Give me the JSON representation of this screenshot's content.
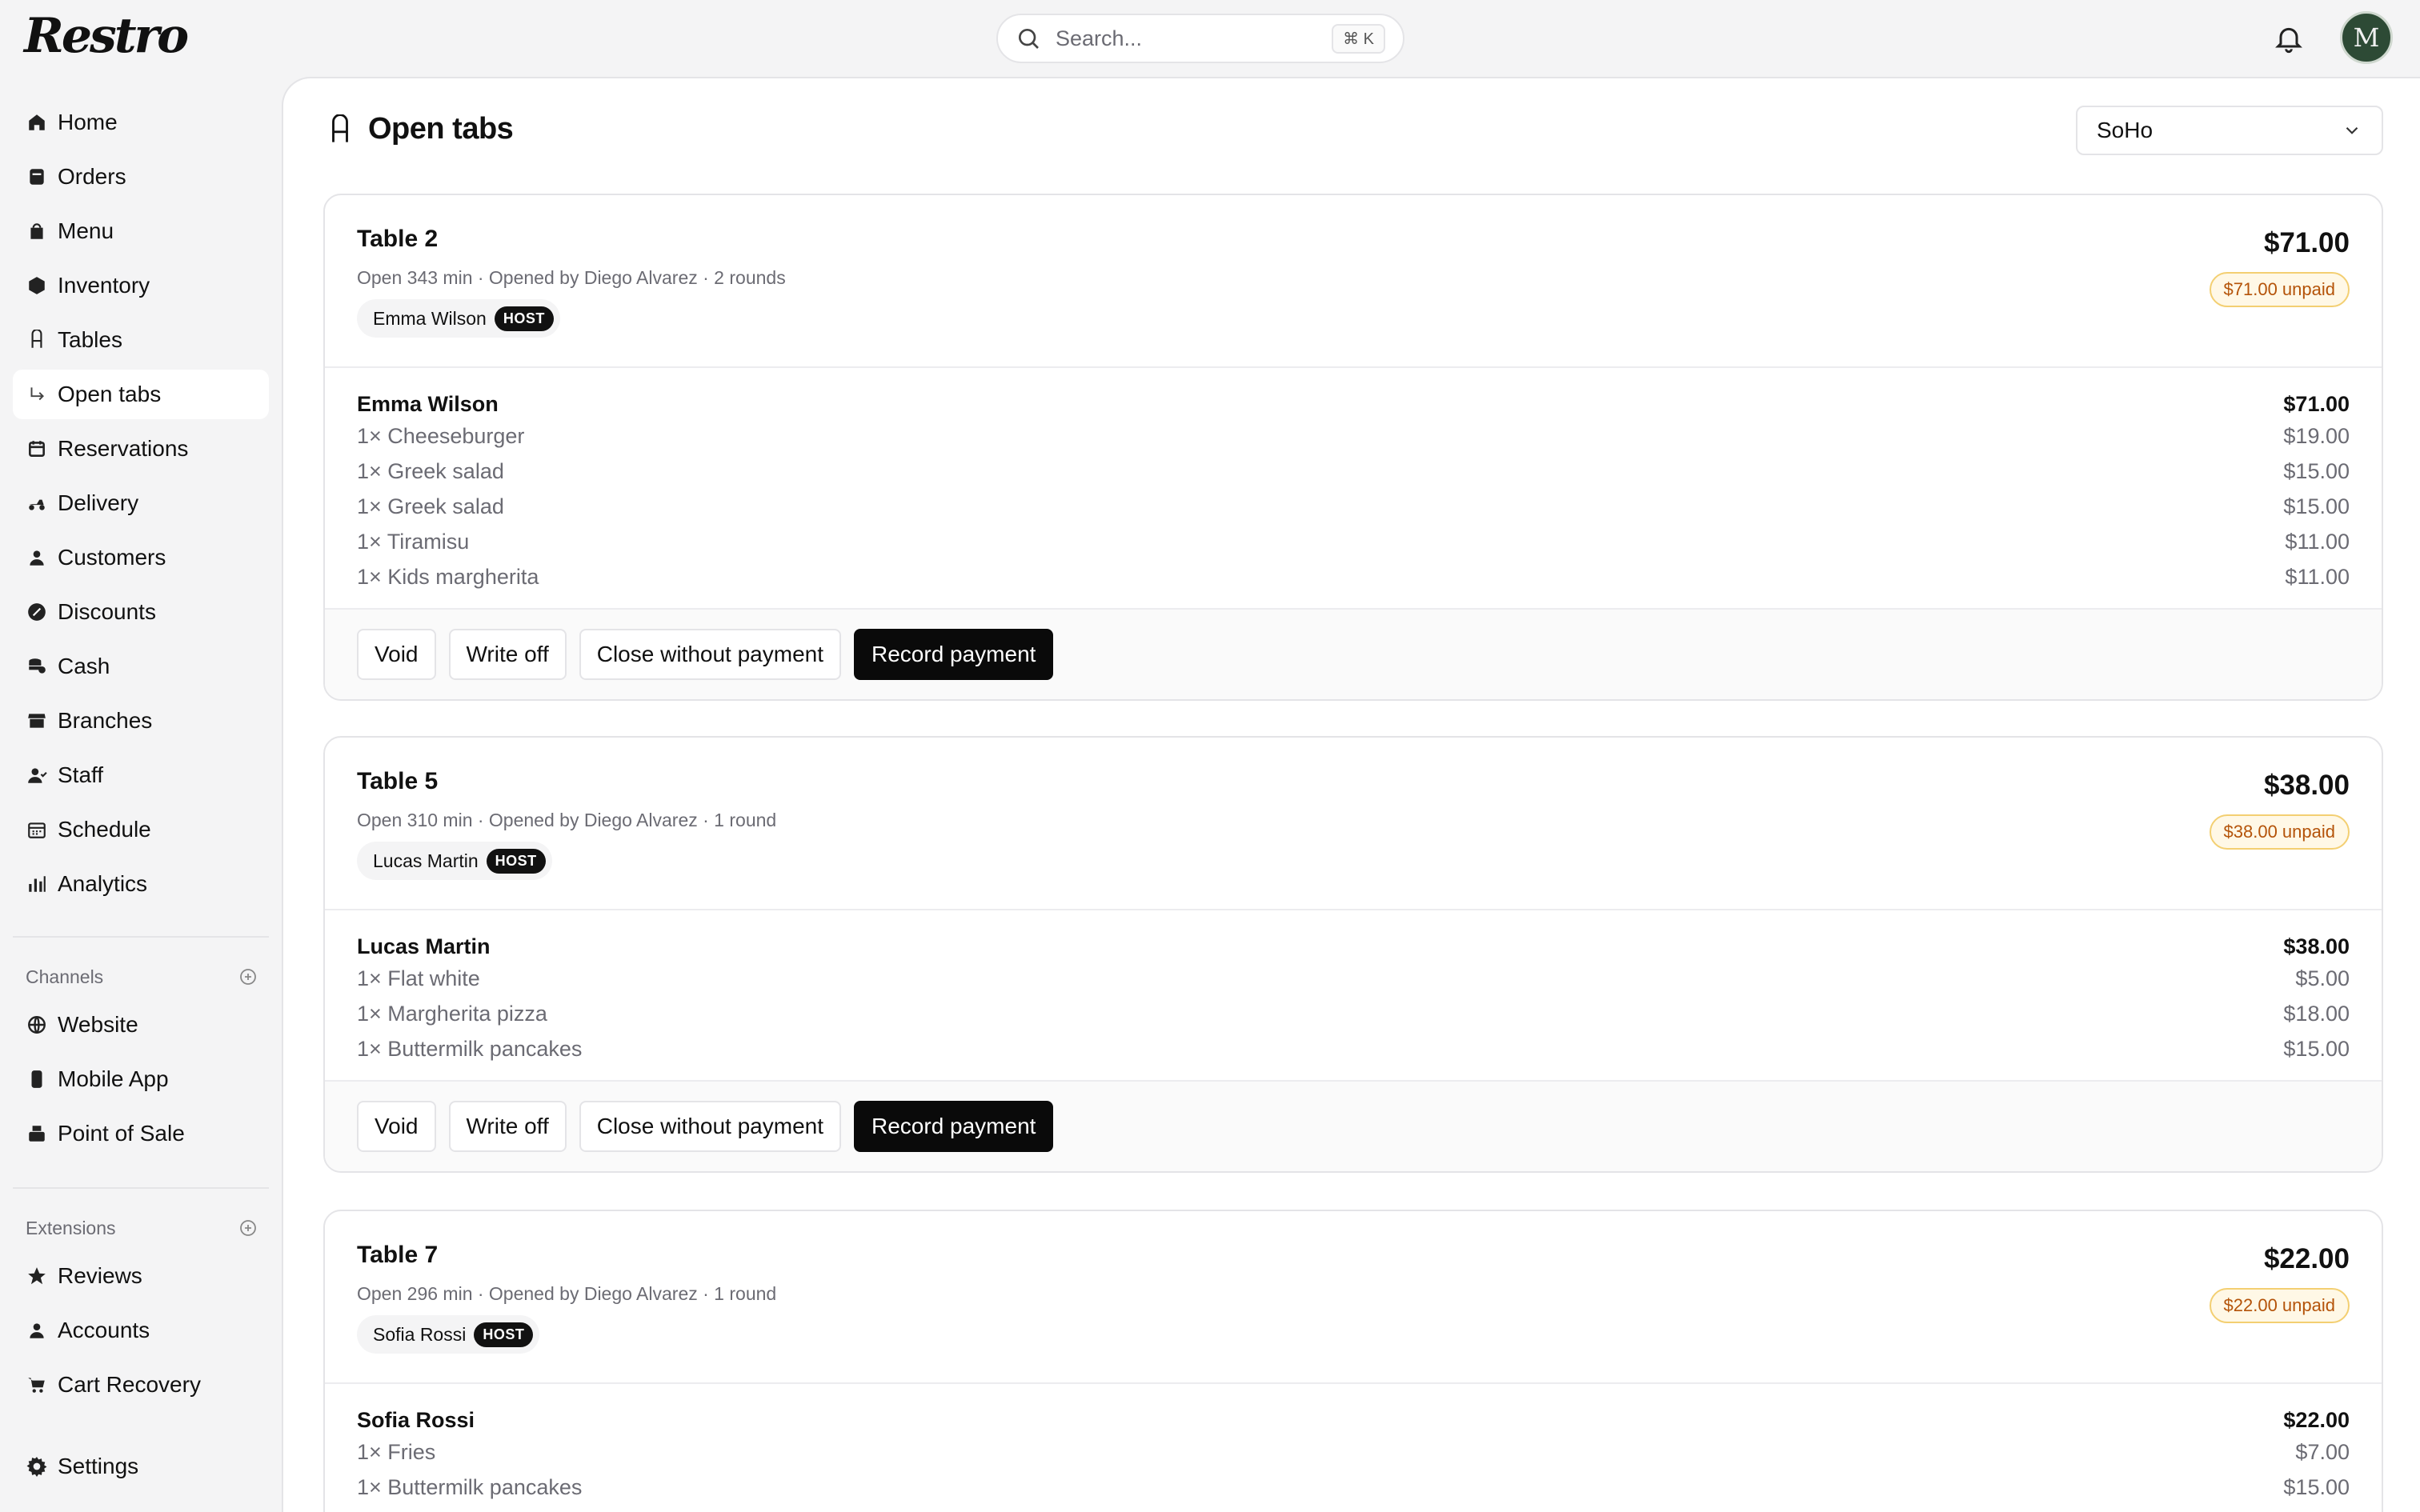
{
  "app": {
    "logo_text": "Restro"
  },
  "search": {
    "placeholder": "Search...",
    "shortcut": "⌘ K"
  },
  "user": {
    "avatar_initial": "M"
  },
  "sidebar": {
    "items": [
      {
        "label": "Home",
        "icon": "home-icon"
      },
      {
        "label": "Orders",
        "icon": "orders-icon"
      },
      {
        "label": "Menu",
        "icon": "menu-icon"
      },
      {
        "label": "Inventory",
        "icon": "inventory-icon"
      },
      {
        "label": "Tables",
        "icon": "chair-icon"
      },
      {
        "label": "Open tabs",
        "icon": "subitem-arrow-icon",
        "active": true
      },
      {
        "label": "Reservations",
        "icon": "calendar-icon"
      },
      {
        "label": "Delivery",
        "icon": "scooter-icon"
      },
      {
        "label": "Customers",
        "icon": "person-icon"
      },
      {
        "label": "Discounts",
        "icon": "discount-icon"
      },
      {
        "label": "Cash",
        "icon": "coins-icon"
      },
      {
        "label": "Branches",
        "icon": "store-icon"
      },
      {
        "label": "Staff",
        "icon": "staff-icon"
      },
      {
        "label": "Schedule",
        "icon": "schedule-icon"
      },
      {
        "label": "Analytics",
        "icon": "analytics-icon"
      }
    ],
    "channels": {
      "heading": "Channels",
      "items": [
        {
          "label": "Website",
          "icon": "globe-icon"
        },
        {
          "label": "Mobile App",
          "icon": "phone-icon"
        },
        {
          "label": "Point of Sale",
          "icon": "pos-icon"
        }
      ]
    },
    "extensions": {
      "heading": "Extensions",
      "items": [
        {
          "label": "Reviews",
          "icon": "star-icon"
        },
        {
          "label": "Accounts",
          "icon": "person-icon"
        },
        {
          "label": "Cart Recovery",
          "icon": "cart-icon"
        }
      ]
    },
    "settings": {
      "label": "Settings",
      "icon": "gear-icon"
    }
  },
  "page": {
    "title": "Open tabs",
    "branch": "SoHo"
  },
  "tabs": [
    {
      "table": "Table 2",
      "meta": "Open 343 min · Opened by Diego Alvarez · 2 rounds",
      "host_name": "Emma Wilson",
      "host_badge": "HOST",
      "total": "$71.00",
      "unpaid": "$71.00 unpaid",
      "guest": "Emma Wilson",
      "guest_total": "$71.00",
      "items": [
        {
          "name": "1× Cheeseburger",
          "price": "$19.00"
        },
        {
          "name": "1× Greek salad",
          "price": "$15.00"
        },
        {
          "name": "1× Greek salad",
          "price": "$15.00"
        },
        {
          "name": "1× Tiramisu",
          "price": "$11.00"
        },
        {
          "name": "1× Kids margherita",
          "price": "$11.00"
        }
      ],
      "actions": {
        "void": "Void",
        "write_off": "Write off",
        "close": "Close without payment",
        "record": "Record payment"
      }
    },
    {
      "table": "Table 5",
      "meta": "Open 310 min · Opened by Diego Alvarez · 1 round",
      "host_name": "Lucas Martin",
      "host_badge": "HOST",
      "total": "$38.00",
      "unpaid": "$38.00 unpaid",
      "guest": "Lucas Martin",
      "guest_total": "$38.00",
      "items": [
        {
          "name": "1× Flat white",
          "price": "$5.00"
        },
        {
          "name": "1× Margherita pizza",
          "price": "$18.00"
        },
        {
          "name": "1× Buttermilk pancakes",
          "price": "$15.00"
        }
      ],
      "actions": {
        "void": "Void",
        "write_off": "Write off",
        "close": "Close without payment",
        "record": "Record payment"
      }
    },
    {
      "table": "Table 7",
      "meta": "Open 296 min · Opened by Diego Alvarez · 1 round",
      "host_name": "Sofia Rossi",
      "host_badge": "HOST",
      "total": "$22.00",
      "unpaid": "$22.00 unpaid",
      "guest": "Sofia Rossi",
      "guest_total": "$22.00",
      "items": [
        {
          "name": "1× Fries",
          "price": "$7.00"
        },
        {
          "name": "1× Buttermilk pancakes",
          "price": "$15.00"
        }
      ]
    }
  ]
}
